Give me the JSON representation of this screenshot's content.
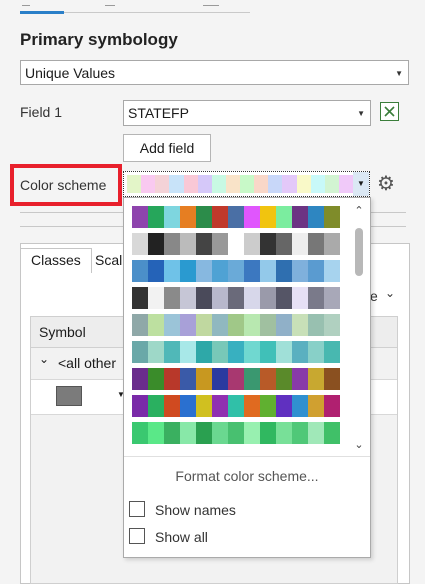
{
  "section_title": "Primary symbology",
  "symbology_type": {
    "value": "Unique Values"
  },
  "field1": {
    "label": "Field 1",
    "value": "STATEFP"
  },
  "add_field_label": "Add field",
  "color_scheme": {
    "label": "Color scheme",
    "selected_ramp": [
      "#e3f5c8",
      "#f9c9f0",
      "#f4d2d7",
      "#c8e3f9",
      "#f9c8d6",
      "#d5c8f9",
      "#c8f9e3",
      "#f9e3c8",
      "#c8f9c8",
      "#f9d7c8",
      "#c8d7f9",
      "#e3c8f9",
      "#f9f9c8",
      "#c8f9f9",
      "#d2f4d2",
      "#f0c9f9"
    ]
  },
  "tabs": {
    "classes": "Classes",
    "scales": "Scal"
  },
  "more_label": "e",
  "table": {
    "header_symbol": "Symbol",
    "row_all_other": "<all other"
  },
  "popup": {
    "format_label": "Format color scheme...",
    "show_names": "Show names",
    "show_all": "Show all",
    "ramps": [
      [
        "#8e44ad",
        "#26a65b",
        "#7ed6df",
        "#e67e22",
        "#2c8c4a",
        "#c0392b",
        "#4a6fa5",
        "#e056fd",
        "#f1c40f",
        "#7bed9f",
        "#6c3483",
        "#2e86c1",
        "#7f8c2a"
      ],
      [
        "#d8d8d8",
        "#222222",
        "#888888",
        "#bbbbbb",
        "#444444",
        "#999999",
        "#ffffff",
        "#cccccc",
        "#333333",
        "#666666",
        "#eeeeee",
        "#777777",
        "#aaaaaa"
      ],
      [
        "#4b8fc9",
        "#2563b8",
        "#6fc2e8",
        "#2a9ad0",
        "#87b8e0",
        "#4fa2d4",
        "#6aaad8",
        "#3c78c0",
        "#93c9ea",
        "#2f6fb0",
        "#7fb0dc",
        "#5a9bd0",
        "#a7d3ee"
      ],
      [
        "#333333",
        "#f2f2f2",
        "#8a8a8a",
        "#c6c6d6",
        "#4a4a5a",
        "#b8b8cc",
        "#6a6a7a",
        "#d7d7ea",
        "#9a9aaa",
        "#555566",
        "#e6e0f5",
        "#7a7a8a",
        "#a8a8b8"
      ],
      [
        "#8fa8a8",
        "#bde0a0",
        "#9bc4d8",
        "#a8a0d8",
        "#c0d8a0",
        "#90b8c0",
        "#a0c888",
        "#b8e8b0",
        "#a0c0a0",
        "#90b0c8",
        "#c8e0b8",
        "#98c0b0",
        "#b0d0c0"
      ],
      [
        "#6aa8a8",
        "#9ed8c8",
        "#50b8b8",
        "#a8e8e8",
        "#2ea8a8",
        "#78c8b8",
        "#38b0c0",
        "#70d8d0",
        "#40c0b8",
        "#a0e0d8",
        "#5ab0c0",
        "#88d0c8",
        "#48b8b0"
      ],
      [
        "#6a2c8c",
        "#3a8c2a",
        "#b8382a",
        "#3a5aa8",
        "#c89820",
        "#2a3aa0",
        "#a83870",
        "#3a9870",
        "#b85a28",
        "#5a8a2a",
        "#883aa8",
        "#c8a830",
        "#8a5020"
      ],
      [
        "#7a2aa8",
        "#2ab060",
        "#d04a20",
        "#2a70d0",
        "#d0c020",
        "#9030b0",
        "#30c0a8",
        "#e06a20",
        "#60b030",
        "#6030c0",
        "#3090d0",
        "#d0a030",
        "#b02070"
      ],
      [
        "#3ac870",
        "#5ae888",
        "#3ab060",
        "#88e8a8",
        "#2aa050",
        "#6ad890",
        "#48c070",
        "#98f0b0",
        "#30b860",
        "#78e098",
        "#50c878",
        "#a0e8b8",
        "#40c068"
      ]
    ]
  }
}
